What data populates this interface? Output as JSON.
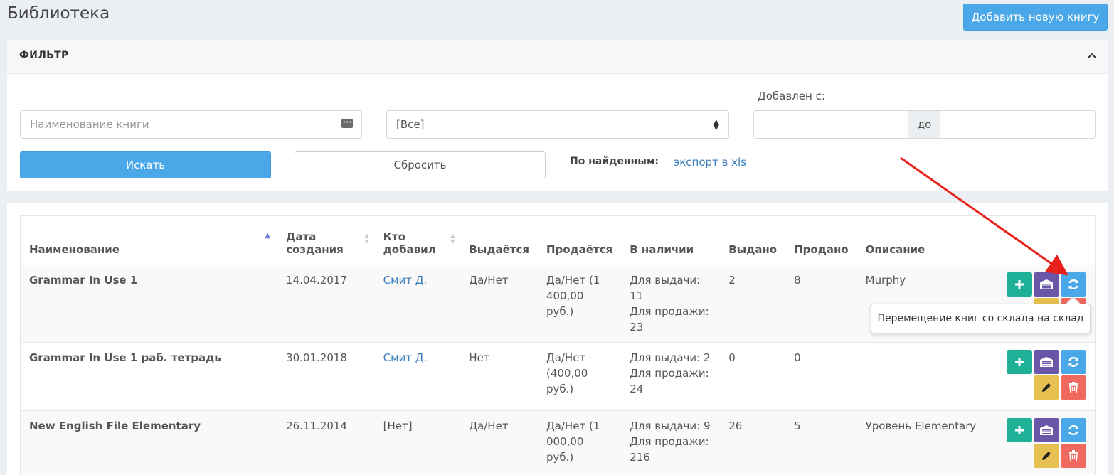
{
  "page": {
    "title": "Библиотека",
    "add_button": "Добавить новую книгу"
  },
  "filter": {
    "title": "ФИЛЬТР",
    "name_placeholder": "Наименование книги",
    "select_value": "[Все]",
    "added_label": "Добавлен с:",
    "date_separator": "до",
    "search_button": "Искать",
    "reset_button": "Сбросить",
    "found_label": "По найденным:",
    "export_link": "экспорт в xls"
  },
  "table": {
    "columns": [
      "Наименование",
      "Дата создания",
      "Кто добавил",
      "Выдаётся",
      "Продаётся",
      "В наличии",
      "Выдано",
      "Продано",
      "Описание"
    ],
    "rows": [
      {
        "name": "Grammar In Use 1",
        "created": "14.04.2017",
        "added_by": "Смит Д.",
        "lending": "Да/Нет",
        "selling": "Да/Нет (1 400,00 руб.)",
        "stock_lend": "Для выдачи: 11",
        "stock_sell": "Для продажи: 23",
        "issued": "2",
        "sold": "8",
        "description": "Murphy"
      },
      {
        "name": "Grammar In Use 1 раб. тетрадь",
        "created": "30.01.2018",
        "added_by": "Смит Д.",
        "lending": "Нет",
        "selling": "Да/Нет (400,00 руб.)",
        "stock_lend": "Для выдачи: 2",
        "stock_sell": "Для продажи: 24",
        "issued": "0",
        "sold": "0",
        "description": ""
      },
      {
        "name": "New English File Elementary",
        "created": "26.11.2014",
        "added_by": "[Нет]",
        "lending": "Да/Нет",
        "selling": "Да/Нет (1 000,00 руб.)",
        "stock_lend": "Для выдачи: 9",
        "stock_sell": "Для продажи: 216",
        "issued": "26",
        "sold": "5",
        "description": "Уровень Elementary"
      }
    ]
  },
  "tooltip": "Перемещение книг со склада на склад",
  "colors": {
    "primary": "#4aa8e8",
    "green": "#1fb198",
    "purple": "#6a56a7",
    "yellow": "#e6c152",
    "red": "#f0695e",
    "arrow": "#e8221b"
  }
}
